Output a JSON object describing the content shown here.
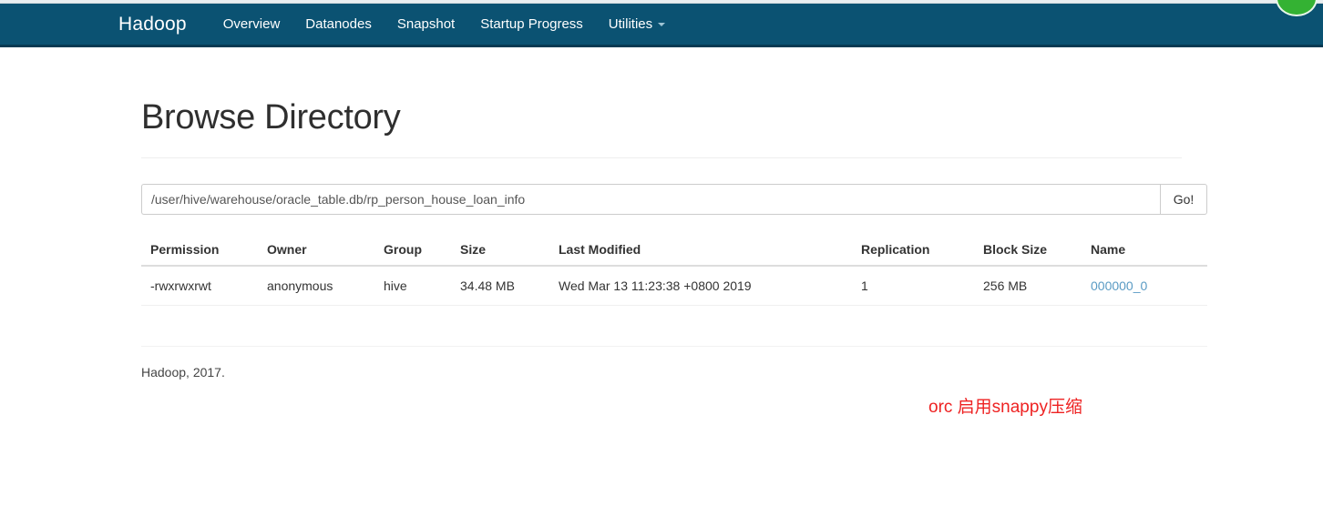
{
  "window": {
    "top_strip_color": "#e9eef0",
    "green_badge_color": "#34b233"
  },
  "navbar": {
    "background": "#0b5272",
    "brand": "Hadoop",
    "items": [
      {
        "label": "Overview",
        "has_caret": false
      },
      {
        "label": "Datanodes",
        "has_caret": false
      },
      {
        "label": "Snapshot",
        "has_caret": false
      },
      {
        "label": "Startup Progress",
        "has_caret": false
      },
      {
        "label": "Utilities",
        "has_caret": true
      }
    ]
  },
  "page": {
    "title": "Browse Directory"
  },
  "path_bar": {
    "value": "/user/hive/warehouse/oracle_table.db/rp_person_house_loan_info",
    "placeholder": "Enter a path",
    "go_label": "Go!"
  },
  "file_table": {
    "headers": [
      "Permission",
      "Owner",
      "Group",
      "Size",
      "Last Modified",
      "Replication",
      "Block Size",
      "Name"
    ],
    "rows": [
      {
        "permission": "-rwxrwxrwt",
        "owner": "anonymous",
        "group": "hive",
        "size": "34.48 MB",
        "last_modified": "Wed Mar 13 11:23:38 +0800 2019",
        "replication": "1",
        "block_size": "256 MB",
        "name": "000000_0"
      }
    ]
  },
  "footer": {
    "text": "Hadoop, 2017."
  },
  "annotation": {
    "text": "orc 启用snappy压缩",
    "color": "#ee2222"
  }
}
